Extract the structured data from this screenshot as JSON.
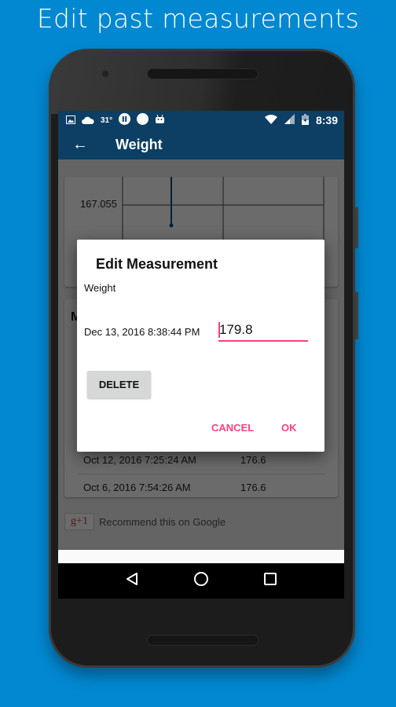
{
  "headline": "Edit past measurements",
  "statusbar": {
    "temperature": "31°",
    "time": "8:39",
    "icons": [
      "image-icon",
      "cloud-icon",
      "pause-icon",
      "circle-icon",
      "android-icon",
      "wifi-icon",
      "signal-icon",
      "battery-icon"
    ]
  },
  "appbar": {
    "back_icon": "←",
    "title": "Weight"
  },
  "chart": {
    "y_tick_label": "167.055"
  },
  "list": {
    "title_partial": "M",
    "rows": [
      {
        "date": "Oct 12, 2016 7:25:24 AM",
        "value": "176.6"
      },
      {
        "date": "Oct 6, 2016 7:54:26 AM",
        "value": "176.6"
      }
    ]
  },
  "gplus": {
    "button_label": "g+1",
    "text": "Recommend this on Google"
  },
  "dialog": {
    "title": "Edit Measurement",
    "label": "Weight",
    "date": "Dec 13, 2016 8:38:44 PM",
    "value": "179.8",
    "delete_label": "DELETE",
    "cancel_label": "CANCEL",
    "ok_label": "OK",
    "accent_color": "#ff4081"
  },
  "colors": {
    "background": "#0288d1",
    "appbar": "#0d3e63"
  }
}
